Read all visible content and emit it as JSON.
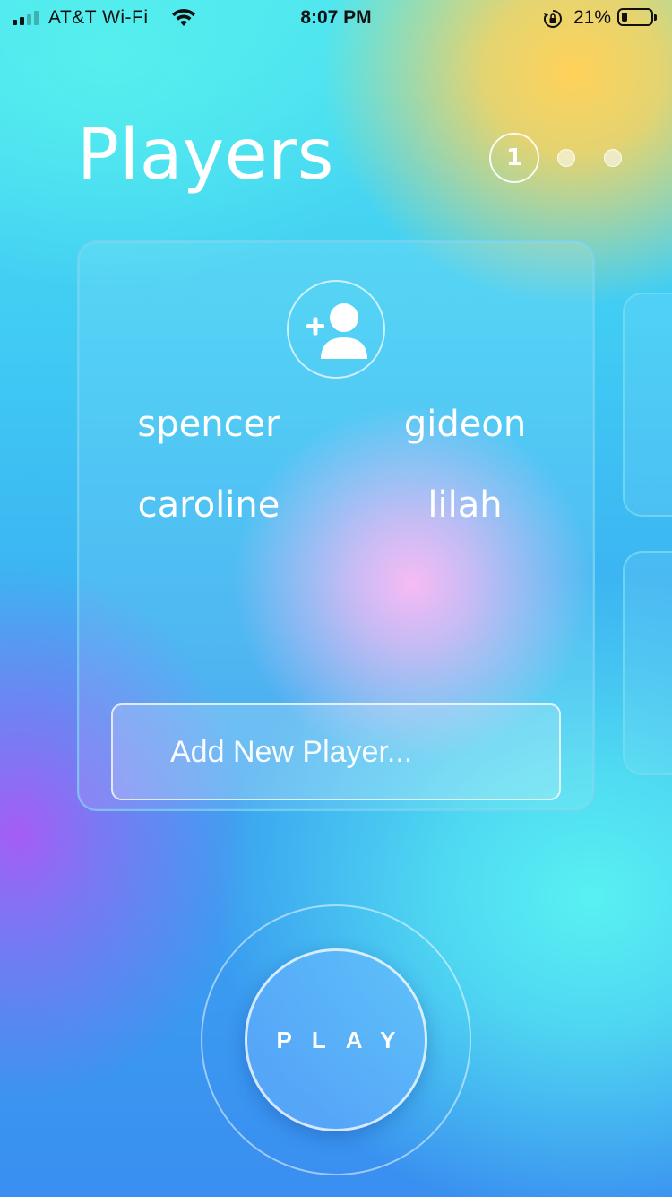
{
  "status_bar": {
    "carrier": "AT&T Wi-Fi",
    "time": "8:07 PM",
    "battery_percent": "21%",
    "battery_level": 0.21,
    "signal_bars_active": 2,
    "signal_bars_total": 4,
    "icons": [
      "cellular-signal-icon",
      "wifi-icon",
      "rotation-lock-icon",
      "battery-icon"
    ]
  },
  "header": {
    "title": "Players",
    "step_current": "1",
    "step_total": 3
  },
  "players_card": {
    "add_icon": "add-person-icon",
    "players": [
      {
        "name": "spencer"
      },
      {
        "name": "gideon"
      },
      {
        "name": "caroline"
      },
      {
        "name": "lilah"
      }
    ],
    "new_player_input": {
      "placeholder": "Add New Player...",
      "value": ""
    }
  },
  "play_button": {
    "label": "PLAY"
  },
  "colors": {
    "accent_yellow": "#ffd25a",
    "accent_purple": "#a55df5",
    "accent_pink": "#f6b4f3",
    "accent_cyan": "#58f1f2",
    "base_blue": "#3a8ff0"
  }
}
